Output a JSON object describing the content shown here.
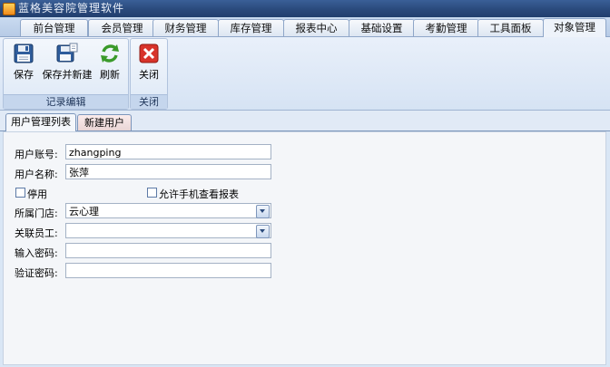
{
  "window": {
    "title": "蓝格美容院管理软件",
    "icon": "app-icon"
  },
  "main_tabs": [
    {
      "label": "前台管理"
    },
    {
      "label": "会员管理"
    },
    {
      "label": "财务管理"
    },
    {
      "label": "库存管理"
    },
    {
      "label": "报表中心"
    },
    {
      "label": "基础设置"
    },
    {
      "label": "考勤管理"
    },
    {
      "label": "工具面板"
    },
    {
      "label": "对象管理",
      "active": true
    }
  ],
  "ribbon": {
    "group_record": {
      "label": "记录编辑",
      "save": "保存",
      "save_new": "保存并新建",
      "refresh": "刷新"
    },
    "group_close": {
      "label": "关闭",
      "close": "关闭"
    }
  },
  "sub_tabs": [
    {
      "label": "用户管理列表",
      "active": true
    },
    {
      "label": "新建用户"
    }
  ],
  "form": {
    "account_label": "用户账号:",
    "account_value": "zhangping",
    "name_label": "用户名称:",
    "name_value": "张萍",
    "disabled_label": "停用",
    "disabled_checked": false,
    "mobile_label": "允许手机查看报表",
    "mobile_checked": false,
    "store_label": "所属门店:",
    "store_value": "云心理",
    "employee_label": "关联员工:",
    "employee_value": "",
    "password_label": "输入密码:",
    "password_value": "",
    "confirm_label": "验证密码:",
    "confirm_value": ""
  },
  "colors": {
    "title_bar": "#2a4a7c",
    "close_red": "#d8332a",
    "refresh_green": "#3a9a2a"
  }
}
